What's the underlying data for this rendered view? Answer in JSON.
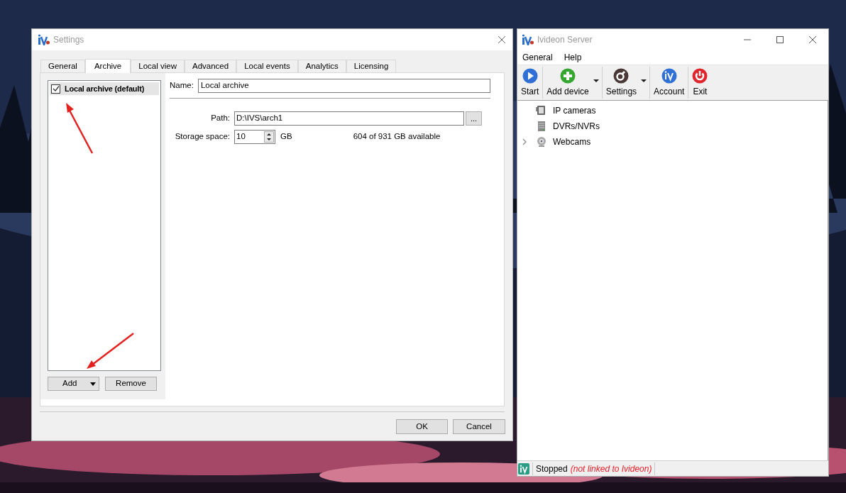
{
  "settings_window": {
    "title": "Settings",
    "tabs": [
      {
        "label": "General",
        "selected": false
      },
      {
        "label": "Archive",
        "selected": true
      },
      {
        "label": "Local view",
        "selected": false
      },
      {
        "label": "Advanced",
        "selected": false
      },
      {
        "label": "Local events",
        "selected": false
      },
      {
        "label": "Analytics",
        "selected": false
      },
      {
        "label": "Licensing",
        "selected": false
      }
    ],
    "archives": [
      {
        "label": "Local archive (default)",
        "checked": true,
        "selected": true
      }
    ],
    "add_button": "Add",
    "remove_button": "Remove",
    "name_label": "Name:",
    "name_value": "Local archive",
    "path_label": "Path:",
    "path_value": "D:\\IVS\\arch1",
    "browse_button": "...",
    "storage_label": "Storage space:",
    "storage_value": "10",
    "storage_unit": "GB",
    "available": "604 of 931 GB available",
    "ok_button": "OK",
    "cancel_button": "Cancel"
  },
  "server_window": {
    "title": "Ivideon Server",
    "menu": [
      "General",
      "Help"
    ],
    "toolbar": [
      {
        "label": "Start",
        "kind": "start",
        "dropdown": false
      },
      {
        "label": "Add device",
        "kind": "add",
        "dropdown": true
      },
      {
        "label": "Settings",
        "kind": "settings",
        "dropdown": true
      },
      {
        "label": "Account",
        "kind": "account",
        "dropdown": false
      },
      {
        "label": "Exit",
        "kind": "exit",
        "dropdown": false
      }
    ],
    "tree": [
      {
        "label": "IP cameras",
        "kind": "ipcam",
        "expandable": false
      },
      {
        "label": "DVRs/NVRs",
        "kind": "dvr",
        "expandable": false
      },
      {
        "label": "Webcams",
        "kind": "webcam",
        "expandable": true
      }
    ],
    "status": {
      "text": "Stopped",
      "note": "(not linked to Ivideon)"
    }
  }
}
